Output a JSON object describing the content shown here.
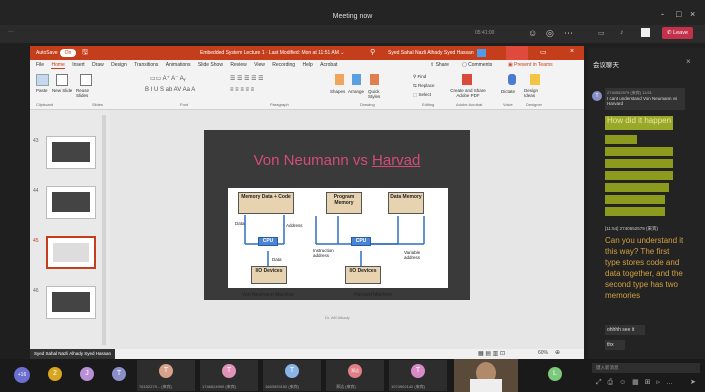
{
  "meeting": {
    "title": "Meeting now",
    "toolbar_time": "05:41:00",
    "leave_label": "Leave",
    "minimize": "-",
    "maximize": "□",
    "close": "×"
  },
  "ppt": {
    "autosave": "AutoSave",
    "toggle": "On",
    "doc_title": "Embedded System Lecture 1 · Last Modified: Mon at 11:51 AM ⌄",
    "user": "Syed Sahal Nazli Alhady Syed Hassan",
    "tabs": [
      "File",
      "Home",
      "Insert",
      "Draw",
      "Design",
      "Transitions",
      "Animations",
      "Slide Show",
      "Review",
      "View",
      "Recording",
      "Help",
      "Acrobat"
    ],
    "share": "Share",
    "comments": "Comments",
    "present": "Present in Teams",
    "groups": [
      "Clipboard",
      "Slides",
      "Font",
      "Paragraph",
      "Drawing",
      "Editing",
      "Adobe Acrobat",
      "Voice",
      "Designer"
    ],
    "ribbon": {
      "paste": "Paste",
      "new_slide": "New Slide",
      "reuse_slides": "Reuse Slides",
      "shapes": "Shapes",
      "arrange": "Arrange",
      "quick_styles": "Quick Styles",
      "find": "Find",
      "replace": "Replace",
      "select": "Select",
      "create_pdf": "Create and Share Adobe PDF",
      "dictate": "Dictate",
      "design_ideas": "Design Ideas"
    },
    "thumb_numbers": [
      "43",
      "44",
      "45",
      "46"
    ],
    "slide": {
      "title_a": "Von Neumann vs ",
      "title_b": "Harvad",
      "left_top": "Memory Data + Code",
      "cpu": "CPU",
      "io": "I/O Devices",
      "data": "Data",
      "address": "Address",
      "left_caption": "Von Neumann Machine",
      "prog_mem": "Program Memory",
      "data_mem": "Data Memory",
      "instr_addr": "Instruction address",
      "var_addr": "Variable address",
      "right_caption": "Harvard Machine",
      "footer": "Dr. Alif Alhady"
    },
    "zoom": "60%",
    "presenter_caption": "Syed Sahal Nazli Alhady Syed Hassan"
  },
  "chat": {
    "title": "会议聊天",
    "first_author": "2740552579 (來宾)",
    "first_time": "11:51",
    "first_msg": "I cant understand Von Neumann vs Harvard",
    "highlight": "How did it happen",
    "second_header": "[11:54] 2740552579 (來宾)",
    "second_msg": "Can you understand it this way? The first type stores code and data together, and the second type has two memories",
    "msg3": "ohhhh see it",
    "msg4": "thx",
    "input_placeholder": "键入新消息"
  },
  "participants": [
    {
      "initial": "+16",
      "color": "#6b6fd0",
      "label": ""
    },
    {
      "initial": "2",
      "color": "#d8a520",
      "label": ""
    },
    {
      "initial": "J",
      "color": "#b98fd6",
      "label": ""
    },
    {
      "initial": "T",
      "color": "#8a8fc8",
      "label": ""
    },
    {
      "initial": "T",
      "color": "#d9a08a",
      "label": "76152279... (來宾)"
    },
    {
      "initial": "T",
      "color": "#e093b6",
      "label": "1746624990 (來宾)"
    },
    {
      "initial": "T",
      "color": "#8ab3e8",
      "label": "1663929152 (來宾)"
    },
    {
      "initial": "郑洁",
      "color": "#e07f86",
      "label": "郑洁 (來宾)"
    },
    {
      "initial": "T",
      "color": "#d88ac6",
      "label": "1074902142 (來宾)"
    },
    {
      "initial": "L",
      "color": "#7cc97c",
      "label": ""
    }
  ]
}
